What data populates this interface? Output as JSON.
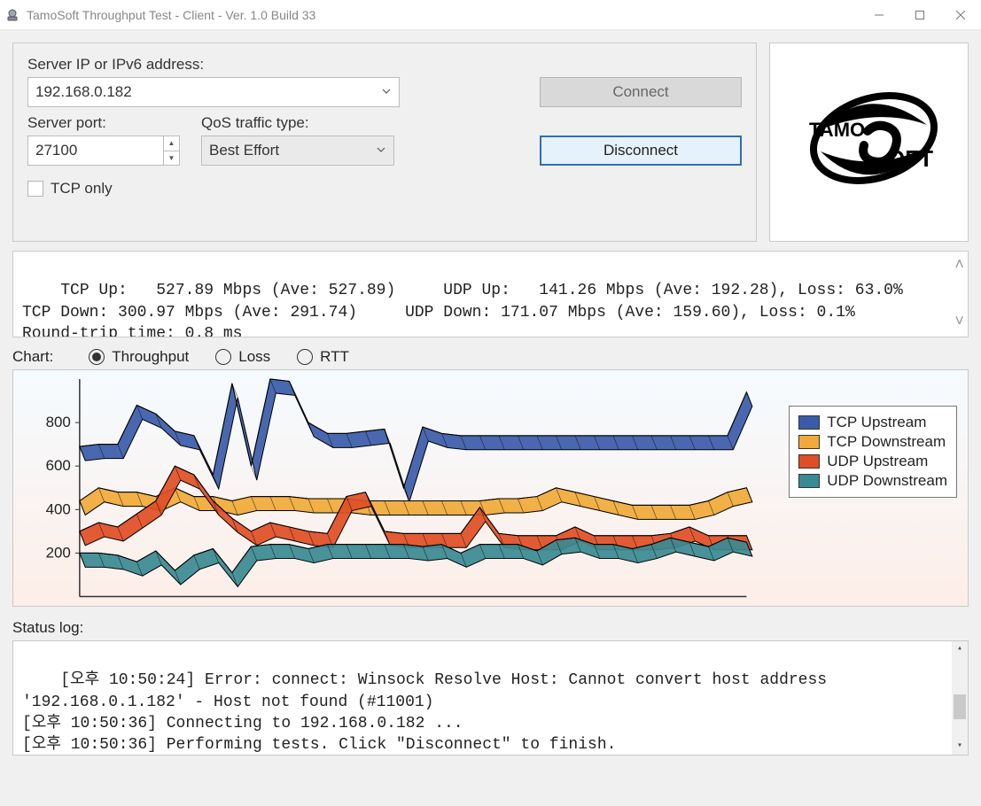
{
  "window": {
    "title": "TamoSoft Throughput Test - Client - Ver. 1.0 Build 33"
  },
  "conn": {
    "server_ip_label": "Server IP or IPv6  address:",
    "server_ip_value": "192.168.0.182",
    "server_port_label": "Server port:",
    "server_port_value": "27100",
    "qos_label": "QoS traffic type:",
    "qos_value": "Best Effort",
    "connect_label": "Connect",
    "disconnect_label": "Disconnect",
    "tcp_only_label": "TCP only"
  },
  "stats_text": "TCP Up:   527.89 Mbps (Ave: 527.89)     UDP Up:   141.26 Mbps (Ave: 192.28), Loss: 63.0%\nTCP Down: 300.97 Mbps (Ave: 291.74)     UDP Down: 171.07 Mbps (Ave: 159.60), Loss: 0.1%\nRound-trip time: 0.8 ms",
  "chart_sel": {
    "label": "Chart:",
    "opt_throughput": "Throughput",
    "opt_loss": "Loss",
    "opt_rtt": "RTT",
    "selected": "throughput"
  },
  "legend": {
    "tcp_up": "TCP Upstream",
    "tcp_down": "TCP Downstream",
    "udp_up": "UDP Upstream",
    "udp_down": "UDP Downstream"
  },
  "colors": {
    "tcp_up": "#3b5ba8",
    "tcp_down": "#f0a93a",
    "udp_up": "#e04e25",
    "udp_down": "#3a8a93"
  },
  "status_label": "Status log:",
  "status_lines": [
    "[오후 10:50:24] Error: connect: Winsock Resolve Host: Cannot convert host address '192.168.0.1.182' - Host not found (#11001)",
    "[오후 10:50:36] Connecting to 192.168.0.182 ...",
    "[오후 10:50:36] Performing tests. Click \"Disconnect\" to finish."
  ],
  "chart_data": {
    "type": "line",
    "xlabel": "",
    "ylabel": "",
    "ylim": [
      0,
      1000
    ],
    "ticks": [
      200,
      400,
      600,
      800
    ],
    "x": [
      0,
      1,
      2,
      3,
      4,
      5,
      6,
      7,
      8,
      9,
      10,
      11,
      12,
      13,
      14,
      15,
      16,
      17,
      18,
      19,
      20,
      21,
      22,
      23,
      24,
      25,
      26,
      27,
      28,
      29,
      30,
      31,
      32,
      33,
      34,
      35
    ],
    "series": [
      {
        "name": "TCP Upstream",
        "color": "#3b5ba8",
        "values": [
          690,
          700,
          700,
          880,
          840,
          760,
          740,
          560,
          980,
          600,
          1000,
          990,
          800,
          750,
          750,
          760,
          770,
          500,
          780,
          750,
          740,
          740,
          740,
          740,
          740,
          740,
          740,
          740,
          740,
          740,
          740,
          740,
          740,
          740,
          740,
          940
        ]
      },
      {
        "name": "TCP Downstream",
        "color": "#f0a93a",
        "values": [
          440,
          500,
          480,
          480,
          460,
          500,
          460,
          460,
          440,
          460,
          460,
          460,
          450,
          450,
          450,
          440,
          440,
          440,
          440,
          440,
          440,
          440,
          450,
          450,
          460,
          500,
          480,
          460,
          440,
          420,
          420,
          420,
          420,
          440,
          480,
          500
        ]
      },
      {
        "name": "UDP Upstream",
        "color": "#e04e25",
        "values": [
          300,
          340,
          320,
          380,
          440,
          600,
          560,
          440,
          360,
          300,
          340,
          320,
          300,
          290,
          460,
          480,
          300,
          290,
          290,
          290,
          290,
          410,
          290,
          280,
          280,
          280,
          320,
          280,
          280,
          280,
          280,
          290,
          320,
          280,
          280,
          280
        ]
      },
      {
        "name": "UDP Downstream",
        "color": "#3a8a93",
        "values": [
          200,
          200,
          190,
          160,
          210,
          120,
          190,
          220,
          110,
          230,
          240,
          240,
          220,
          240,
          240,
          240,
          240,
          240,
          230,
          240,
          200,
          240,
          240,
          240,
          210,
          260,
          270,
          240,
          240,
          220,
          240,
          270,
          250,
          230,
          270,
          250
        ]
      }
    ]
  }
}
